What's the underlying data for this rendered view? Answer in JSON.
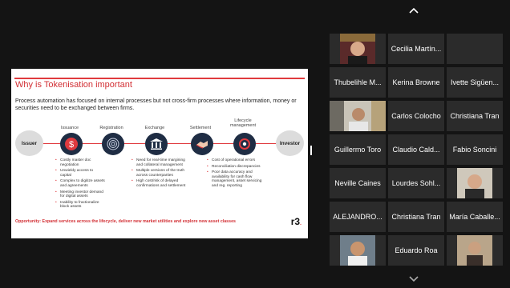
{
  "slide": {
    "title": "Why is Tokenisation important",
    "subtitle": "Process automation has focused on internal processes but not cross-firm processes where information, money or securities need to be exchanged between firms.",
    "issuer": "Issuer",
    "investor": "Investor",
    "stages": [
      {
        "label": "Issuance",
        "bullets": [
          "Costly master doc negotiation",
          "Unwieldy access to capital",
          "Complex to digitize assets and agreements",
          "Meeting investor demand for digital assets",
          "Inability to fractionalize block assets"
        ]
      },
      {
        "label": "Registration",
        "bullets": []
      },
      {
        "label": "Exchange",
        "bullets": [
          "Need for real-time margining and collateral management",
          "Multiple versions of the truth across counterparties",
          "High cost/risk of delayed confirmations and settlement"
        ]
      },
      {
        "label": "Settlement",
        "bullets": []
      },
      {
        "label": "Lifecycle management",
        "bullets": [
          "Cost of operational errors",
          "Reconciliation discrepancies",
          "Poor data accuracy and availability for cash flow management, asset servicing and reg. reporting"
        ]
      }
    ],
    "opportunity": "Opportunity: Expand services across the lifecycle, deliver new market utilities and explore new asset classes",
    "logo": "r3",
    "logo_dot": "."
  },
  "participants": [
    {
      "name": "",
      "video": true
    },
    {
      "name": "Cecilia Martín...",
      "video": false
    },
    {
      "name": "",
      "video": false
    },
    {
      "name": "Thubelihle M...",
      "video": false
    },
    {
      "name": "Kerina Browne",
      "video": false
    },
    {
      "name": "Ivette Sigüen...",
      "video": false
    },
    {
      "name": "",
      "video": true
    },
    {
      "name": "Carlos Colocho",
      "video": false
    },
    {
      "name": "Christiana Tran",
      "video": false
    },
    {
      "name": "Guillermo Toro",
      "video": false
    },
    {
      "name": "Claudio Cald...",
      "video": false
    },
    {
      "name": "Fabio Soncini",
      "video": false
    },
    {
      "name": "Neville Caines",
      "video": false
    },
    {
      "name": "Lourdes Sohl...",
      "video": false
    },
    {
      "name": "",
      "video": true
    },
    {
      "name": "ALEJANDRO...",
      "video": false
    },
    {
      "name": "Christiana Tran",
      "video": false
    },
    {
      "name": "María Caballe...",
      "video": false
    },
    {
      "name": "",
      "video": true
    },
    {
      "name": "Eduardo Roa",
      "video": false
    },
    {
      "name": "",
      "video": true
    }
  ],
  "colors": {
    "accent": "#e03a3e",
    "stage_dark": "#1f2d44",
    "tile": "#2b2b2b"
  }
}
